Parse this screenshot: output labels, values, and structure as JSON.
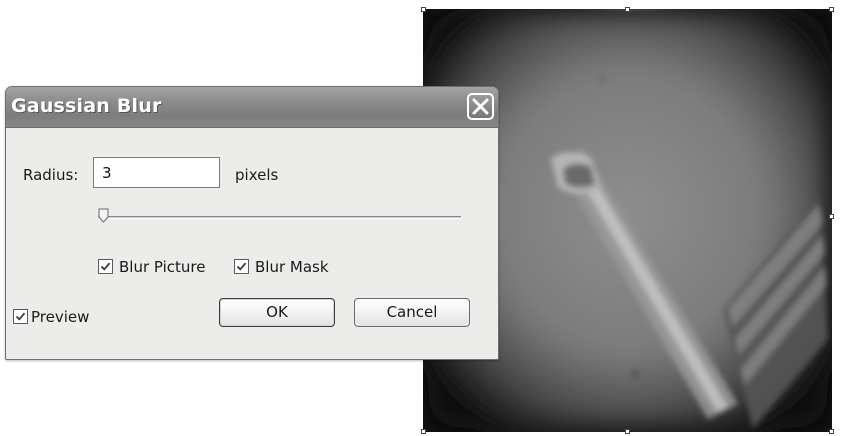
{
  "dialog": {
    "title": "Gaussian Blur",
    "radius_label": "Radius:",
    "radius_value": "3",
    "radius_units": "pixels",
    "slider_level": 0.0,
    "blur_picture_label": "Blur Picture",
    "blur_picture_checked": true,
    "blur_mask_label": "Blur Mask",
    "blur_mask_checked": true,
    "preview_label": "Preview",
    "preview_checked": true,
    "ok_label": "OK",
    "cancel_label": "Cancel"
  },
  "icons": {
    "close": "close-icon",
    "checkmark": "checkmark-icon",
    "slider_thumb": "slider-thumb-icon"
  },
  "colors": {
    "titlebar": "#8d8d8d",
    "dialog_bg": "#ececea",
    "preview_bg": "#1e1e1e"
  }
}
